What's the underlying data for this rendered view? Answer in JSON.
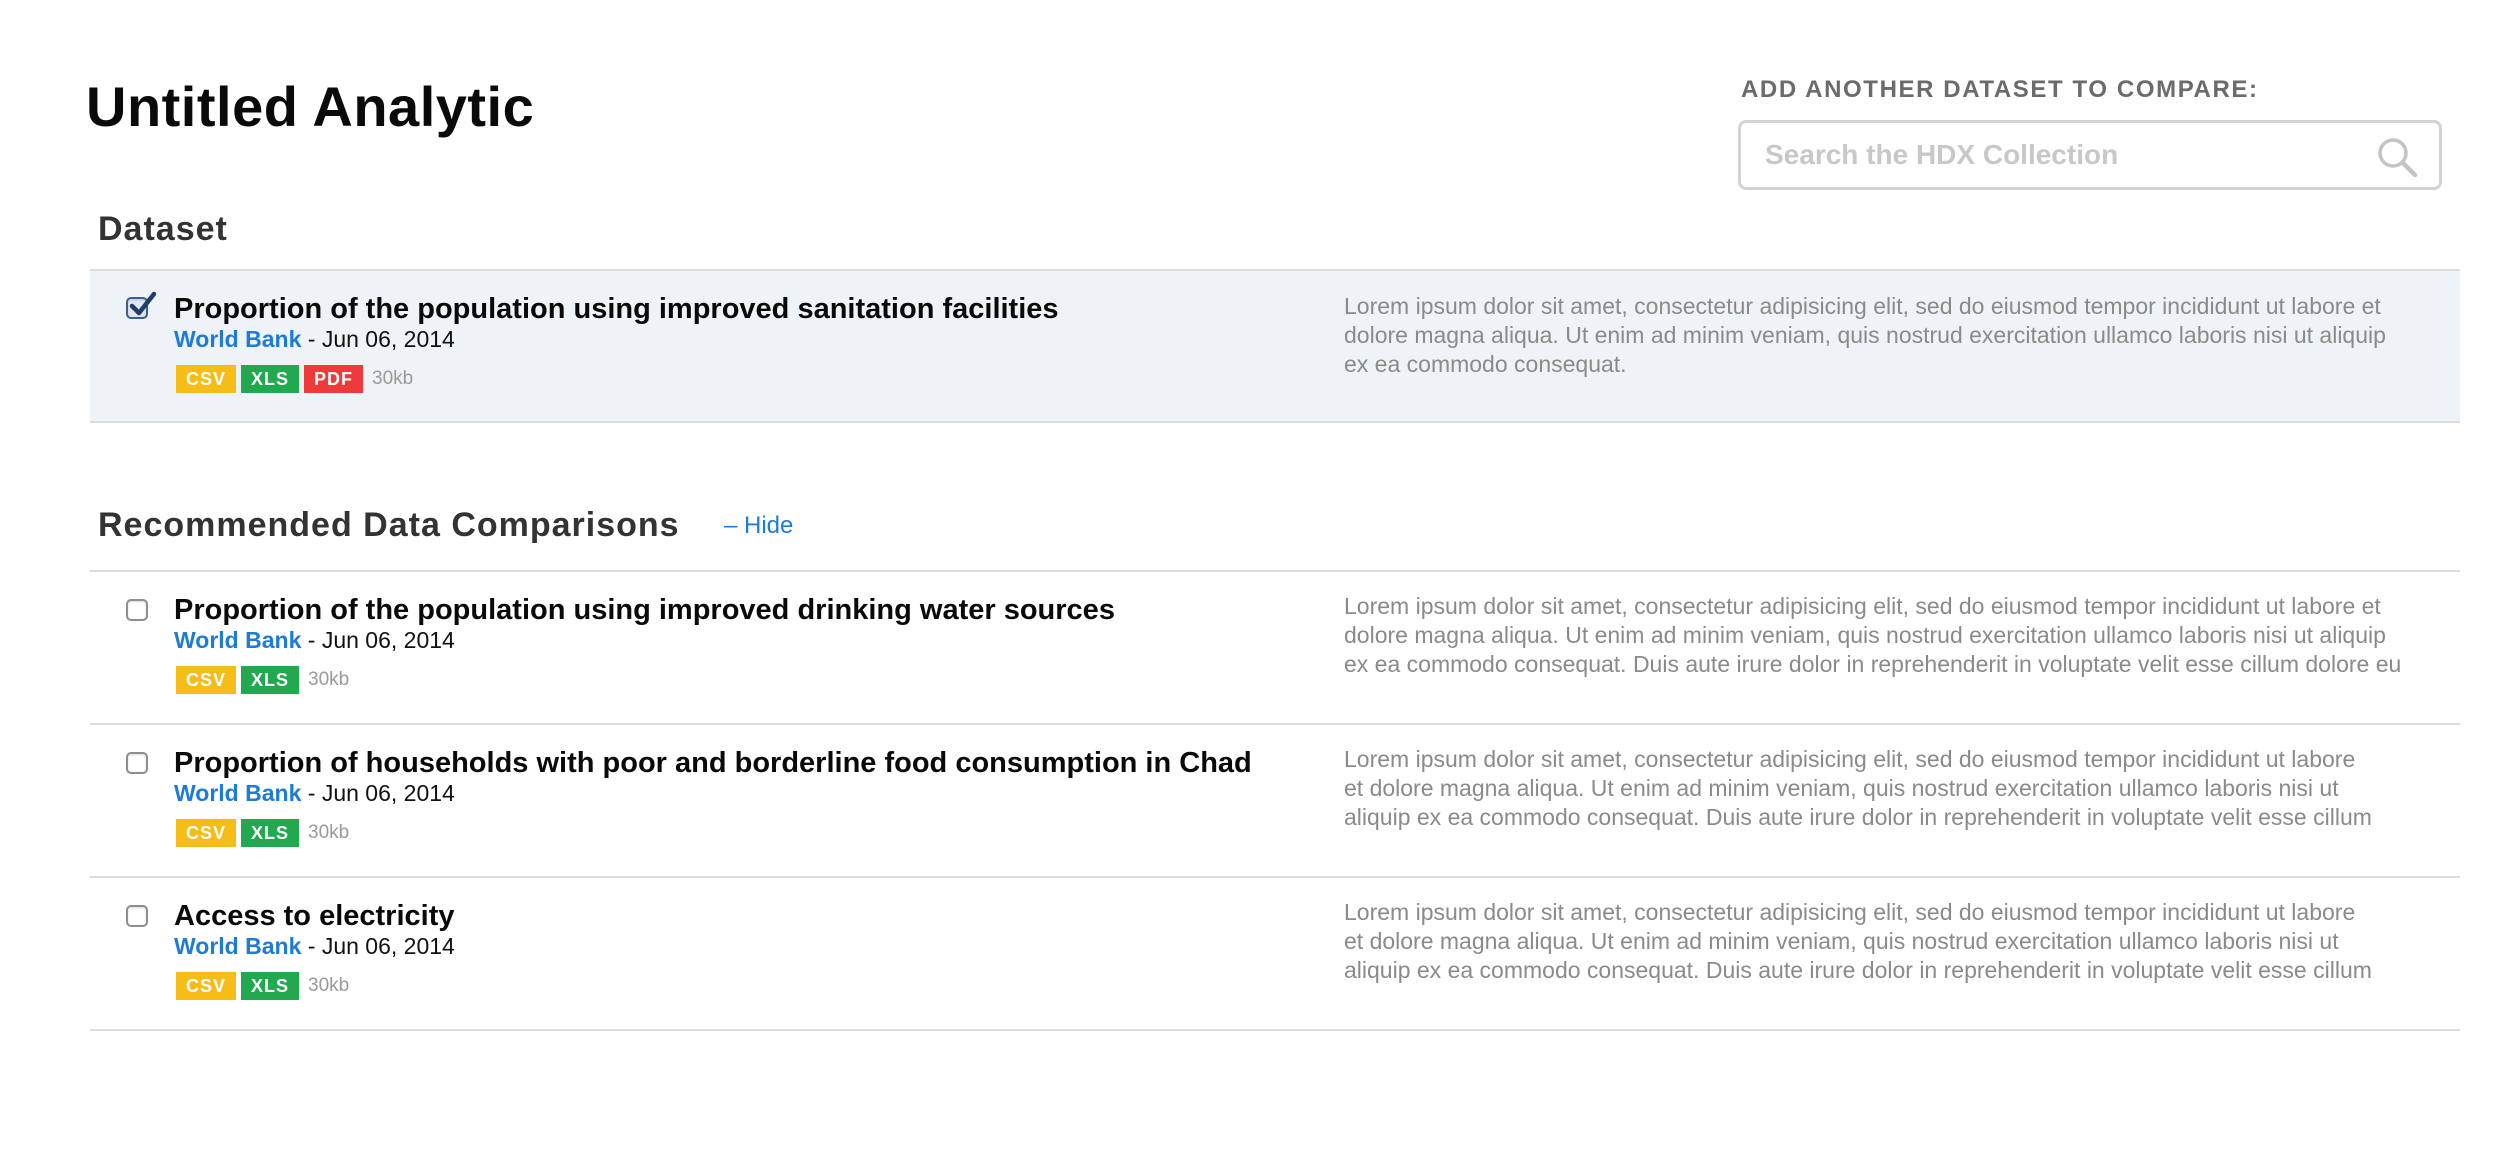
{
  "page": {
    "title": "Untitled Analytic"
  },
  "compare": {
    "label": "ADD ANOTHER DATASET TO COMPARE:",
    "search_placeholder": "Search the HDX Collection",
    "search_icon": "search-icon"
  },
  "dataset_section": {
    "heading": "Dataset",
    "item": {
      "checked": true,
      "title": "Proportion of the population using improved sanitation facilities",
      "source": "World Bank",
      "date": "- Jun 06, 2014",
      "formats": [
        "CSV",
        "XLS",
        "PDF"
      ],
      "size": "30kb",
      "description": [
        "Lorem ipsum dolor sit amet, consectetur adipisicing elit, sed do eiusmod tempor incididunt ut labore et",
        "dolore magna aliqua. Ut enim ad minim veniam, quis nostrud exercitation ullamco laboris nisi ut aliquip",
        "ex ea commodo consequat."
      ]
    }
  },
  "recommended_section": {
    "heading": "Recommended Data Comparisons",
    "hide_label": "– Hide",
    "items": [
      {
        "checked": false,
        "title": "Proportion of the population using improved drinking water sources",
        "source": "World Bank",
        "date": "- Jun 06, 2014",
        "formats": [
          "CSV",
          "XLS"
        ],
        "size": "30kb",
        "description": [
          "Lorem ipsum dolor sit amet, consectetur adipisicing elit, sed do eiusmod tempor incididunt ut labore et",
          "dolore magna aliqua. Ut enim ad minim veniam, quis nostrud exercitation ullamco laboris nisi ut aliquip",
          "ex ea commodo consequat. Duis aute irure dolor in reprehenderit in voluptate velit esse cillum dolore eu"
        ]
      },
      {
        "checked": false,
        "title": "Proportion of households with poor and borderline food consumption in Chad",
        "source": "World Bank",
        "date": "- Jun 06, 2014",
        "formats": [
          "CSV",
          "XLS"
        ],
        "size": "30kb",
        "description": [
          "Lorem ipsum dolor sit amet, consectetur adipisicing elit, sed do eiusmod tempor incididunt ut labore",
          "et dolore magna aliqua. Ut enim ad minim veniam, quis nostrud exercitation ullamco laboris nisi ut",
          "aliquip ex ea commodo consequat. Duis aute irure dolor in reprehenderit in voluptate velit esse cillum"
        ]
      },
      {
        "checked": false,
        "title": "Access to electricity",
        "source": "World Bank",
        "date": "- Jun 06, 2014",
        "formats": [
          "CSV",
          "XLS"
        ],
        "size": "30kb",
        "description": [
          "Lorem ipsum dolor sit amet, consectetur adipisicing elit, sed do eiusmod tempor incididunt ut labore",
          "et dolore magna aliqua. Ut enim ad minim veniam, quis nostrud exercitation ullamco laboris nisi ut",
          "aliquip ex ea commodo consequat. Duis aute irure dolor in reprehenderit in voluptate velit esse cillum"
        ]
      }
    ]
  },
  "colors": {
    "link": "#1e7bd6",
    "csv": "#f6bd18",
    "xls": "#22a94f",
    "pdf": "#ee3a3a",
    "selected_row": "#eef3f8"
  }
}
